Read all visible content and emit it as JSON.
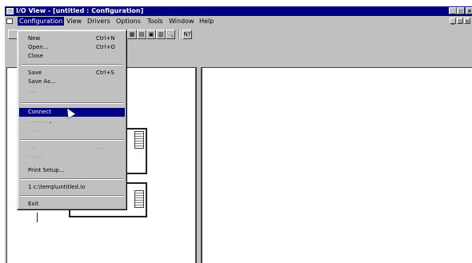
{
  "window": {
    "title": "I/O View - [untitled : Configuration]"
  },
  "title_buttons": {
    "minimize": "_",
    "restore": "▫",
    "close": "×"
  },
  "menubar": {
    "items": [
      {
        "label": "Configuration",
        "active": true
      },
      {
        "label": "View"
      },
      {
        "label": "Drivers"
      },
      {
        "label": "Options"
      },
      {
        "label": "Tools"
      },
      {
        "label": "Window"
      },
      {
        "label": "Help"
      }
    ],
    "mdi": {
      "minimize": "_",
      "restore": "▫",
      "close": "×"
    }
  },
  "toolbar": {
    "icons": [
      "new-icon",
      "device-icon",
      "chart-icon",
      "window-icon",
      "module-icon",
      "zoom-icon",
      "help-icon"
    ],
    "glyphs": [
      "",
      "▦",
      "▤",
      "▣",
      "▥",
      "🔍",
      "N?"
    ]
  },
  "configuration_menu": {
    "items": [
      {
        "label": "New",
        "shortcut": "Ctrl+N"
      },
      {
        "label": "Open...",
        "shortcut": "Ctrl+O"
      },
      {
        "label": "Close",
        "shortcut": ""
      },
      {
        "label": "Save",
        "shortcut": "Ctrl+S"
      },
      {
        "label": "Save As...",
        "shortcut": ""
      },
      {
        "label": "Connect",
        "shortcut": "",
        "selected": true
      },
      {
        "label": "Print Setup...",
        "shortcut": ""
      },
      {
        "label": "1 c:\\temp\\untitled.io",
        "shortcut": ""
      },
      {
        "label": "Exit",
        "shortcut": ""
      }
    ]
  }
}
